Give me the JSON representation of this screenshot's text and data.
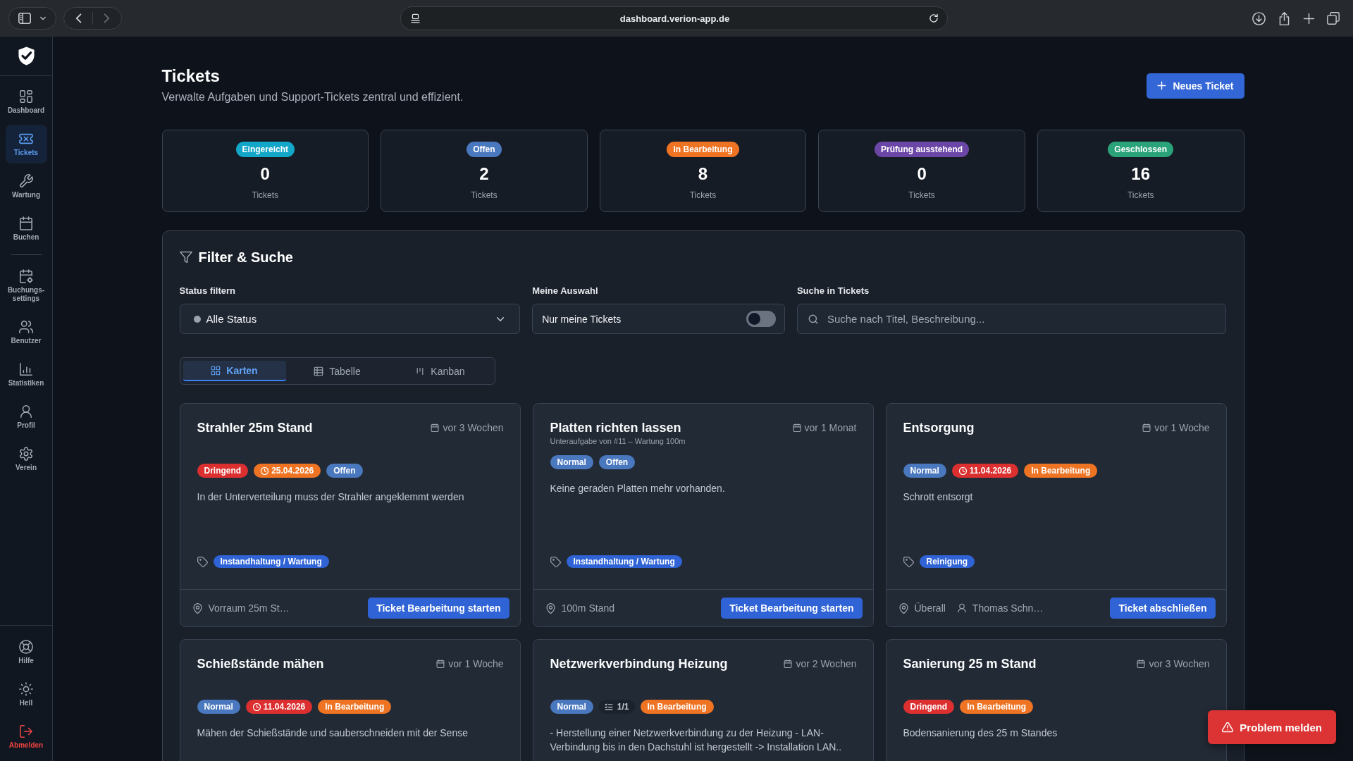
{
  "browser": {
    "url": "dashboard.verion-app.de",
    "can_go_back": true,
    "can_go_forward": false
  },
  "sidebar": {
    "groups": [
      {
        "items": [
          {
            "label": "Dashboard",
            "selected": false
          },
          {
            "label": "Tickets",
            "selected": true
          },
          {
            "label": "Wartung",
            "selected": false
          },
          {
            "label": "Buchen",
            "selected": false
          }
        ]
      },
      {
        "items": [
          {
            "label": "Buchungs-settings",
            "selected": false
          },
          {
            "label": "Benutzer",
            "selected": false
          },
          {
            "label": "Statistiken",
            "selected": false
          },
          {
            "label": "Profil",
            "selected": false
          },
          {
            "label": "Verein",
            "selected": false
          }
        ]
      }
    ],
    "footer_items": [
      {
        "label": "Hilfe",
        "kind": "default"
      },
      {
        "label": "Hell",
        "kind": "default"
      },
      {
        "label": "Abmelden",
        "kind": "danger"
      }
    ]
  },
  "header": {
    "title": "Tickets",
    "subtitle": "Verwalte Aufgaben und Support-Tickets zentral und effizient.",
    "new_button": "Neues Ticket"
  },
  "stats": [
    {
      "label": "Eingereicht",
      "color": "#12a6c8",
      "count": "0",
      "unit": "Tickets"
    },
    {
      "label": "Offen",
      "color": "#4a78bf",
      "count": "2",
      "unit": "Tickets"
    },
    {
      "label": "In Bearbeitung",
      "color": "#ee7424",
      "count": "8",
      "unit": "Tickets"
    },
    {
      "label": "Prüfung ausstehend",
      "color": "#6b46a6",
      "count": "0",
      "unit": "Tickets"
    },
    {
      "label": "Geschlossen",
      "color": "#2aa37a",
      "count": "16",
      "unit": "Tickets"
    }
  ],
  "filter": {
    "title": "Filter & Suche",
    "status": {
      "label": "Status filtern",
      "value": "Alle Status"
    },
    "mine": {
      "label": "Meine Auswahl",
      "text": "Nur meine Tickets",
      "on": false
    },
    "search": {
      "label": "Suche in Tickets",
      "placeholder": "Suche nach Titel, Beschreibung..."
    }
  },
  "view_tabs": [
    {
      "label": "Karten",
      "selected": true
    },
    {
      "label": "Tabelle",
      "selected": false
    },
    {
      "label": "Kanban",
      "selected": false
    }
  ],
  "tickets": [
    {
      "title": "Strahler 25m Stand",
      "age": "vor 3 Wochen",
      "badges": [
        {
          "kind": "label",
          "text": "Dringend",
          "color": "#dc3030"
        },
        {
          "kind": "due",
          "text": "25.04.2026",
          "color": "#ee7424"
        },
        {
          "kind": "label",
          "text": "Offen",
          "color": "#4a78bf"
        }
      ],
      "description": "In der Unterverteilung muss der Strahler angeklemmt werden",
      "tags": [
        "Instandhaltung / Wartung"
      ],
      "location": "Vorraum 25m St…",
      "action": "Ticket Bearbeitung starten"
    },
    {
      "title": "Platten richten lassen",
      "subtitle": "Unteraufgabe von #11 – Wartung 100m",
      "age": "vor 1 Monat",
      "badges": [
        {
          "kind": "label",
          "text": "Normal",
          "color": "#4a78bf"
        },
        {
          "kind": "label",
          "text": "Offen",
          "color": "#4a78bf"
        }
      ],
      "description": "Keine geraden Platten mehr vorhanden.",
      "tags": [
        "Instandhaltung / Wartung"
      ],
      "location": "100m Stand",
      "action": "Ticket Bearbeitung starten"
    },
    {
      "title": "Entsorgung",
      "age": "vor 1 Woche",
      "badges": [
        {
          "kind": "label",
          "text": "Normal",
          "color": "#4a78bf"
        },
        {
          "kind": "due",
          "text": "11.04.2026",
          "color": "#dc3030"
        },
        {
          "kind": "label",
          "text": "In Bearbeitung",
          "color": "#ee7424"
        }
      ],
      "description": "Schrott entsorgt",
      "tags": [
        "Reinigung"
      ],
      "location": "Überall",
      "assignee": "Thomas Schn…",
      "action": "Ticket abschließen"
    },
    {
      "title": "Schießstände mähen",
      "age": "vor 1 Woche",
      "badges": [
        {
          "kind": "label",
          "text": "Normal",
          "color": "#4a78bf"
        },
        {
          "kind": "due",
          "text": "11.04.2026",
          "color": "#dc3030"
        },
        {
          "kind": "label",
          "text": "In Bearbeitung",
          "color": "#ee7424"
        }
      ],
      "description": "Mähen der Schießstände und sauberschneiden mit der Sense"
    },
    {
      "title": "Netzwerkverbindung Heizung",
      "age": "vor 2 Wochen",
      "badges": [
        {
          "kind": "label",
          "text": "Normal",
          "color": "#4a78bf"
        },
        {
          "kind": "subtasks",
          "text": "1/1"
        },
        {
          "kind": "label",
          "text": "In Bearbeitung",
          "color": "#ee7424"
        }
      ],
      "description": "- Herstellung einer Netzwerkverbindung zu der Heizung - LAN-Verbindung bis in den Dachstuhl ist hergestellt -> Installation LAN.."
    },
    {
      "title": "Sanierung 25 m Stand",
      "age": "vor 3 Wochen",
      "badges": [
        {
          "kind": "label",
          "text": "Dringend",
          "color": "#dc3030"
        },
        {
          "kind": "label",
          "text": "In Bearbeitung",
          "color": "#ee7424"
        }
      ],
      "description": "Bodensanierung des 25 m Standes"
    }
  ],
  "report_button": "Problem melden"
}
